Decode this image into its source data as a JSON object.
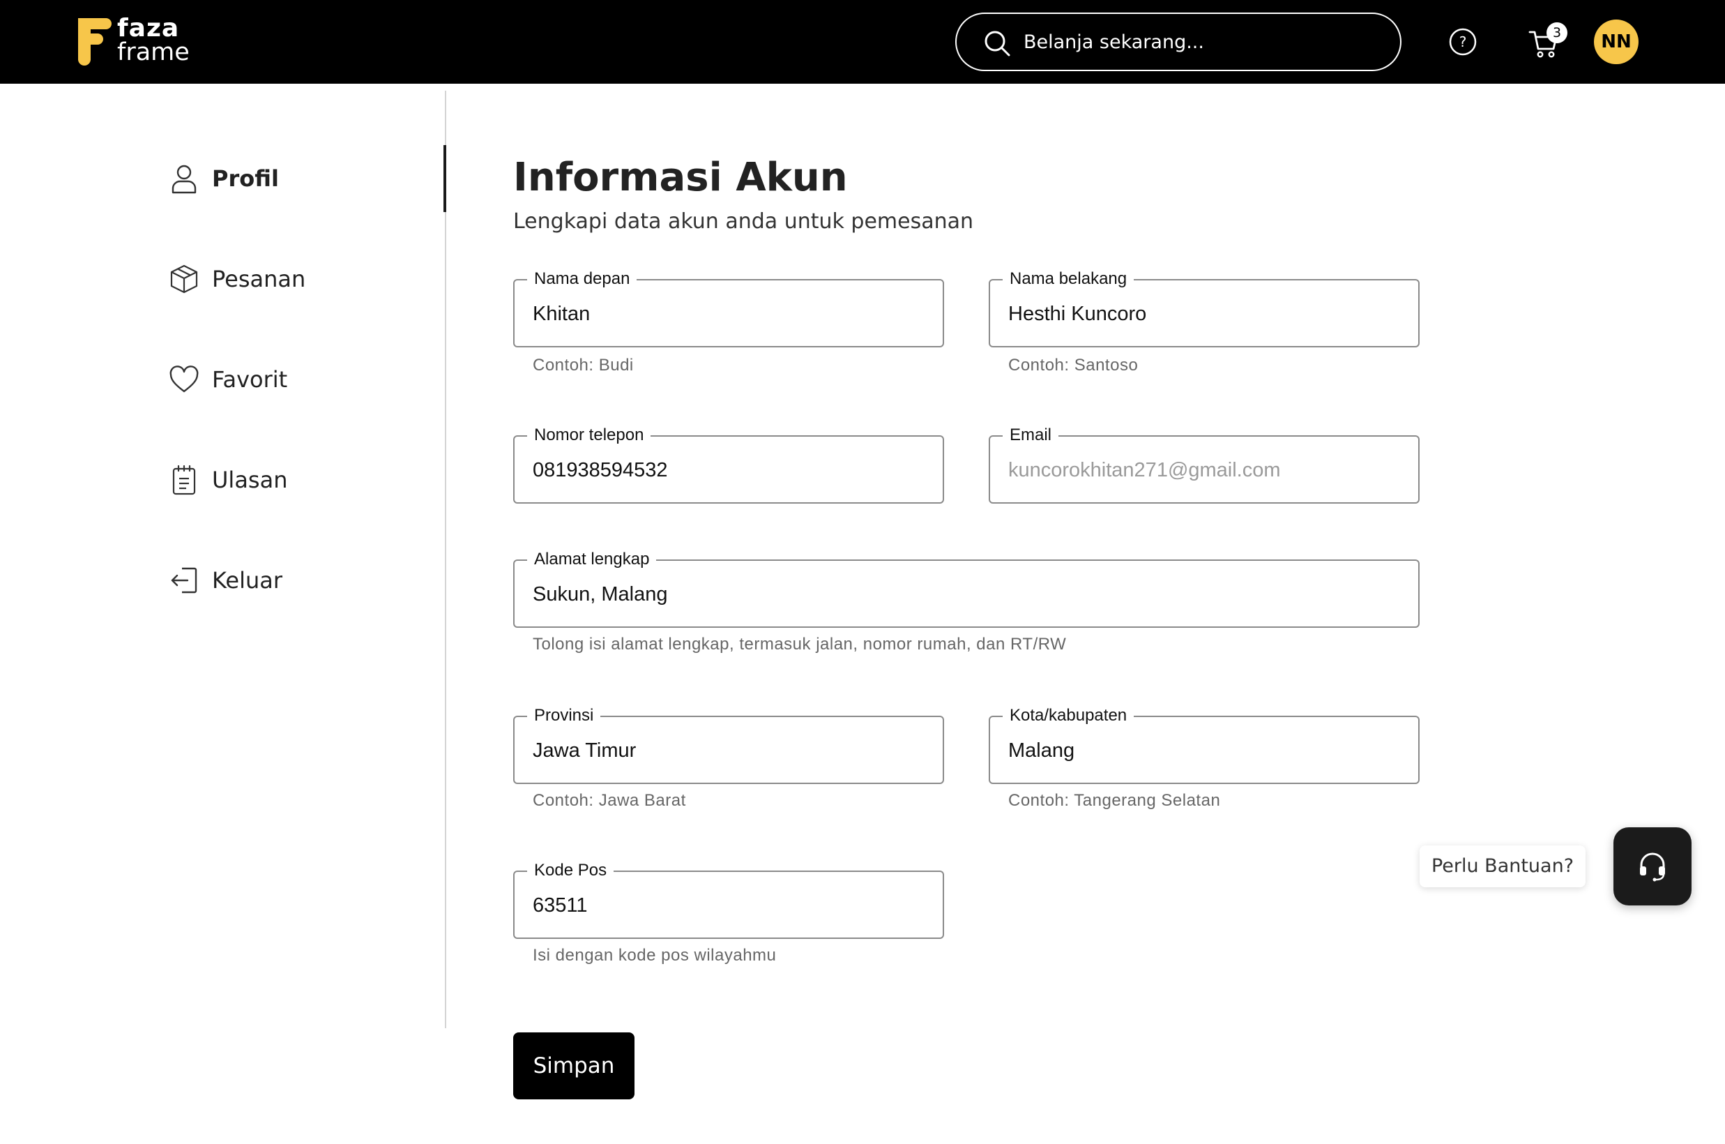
{
  "header": {
    "logo_line1": "faza",
    "logo_line2": "frame",
    "search_placeholder": "Belanja sekarang...",
    "help_icon": "question-circle-icon",
    "cart_icon": "shopping-cart-icon",
    "cart_count": "3",
    "avatar_initials": "NN"
  },
  "sidebar": {
    "items": [
      {
        "label": "Profil",
        "icon": "user-icon",
        "active": true
      },
      {
        "label": "Pesanan",
        "icon": "package-box-icon",
        "active": false
      },
      {
        "label": "Favorit",
        "icon": "heart-icon",
        "active": false
      },
      {
        "label": "Ulasan",
        "icon": "notepad-icon",
        "active": false
      },
      {
        "label": "Keluar",
        "icon": "logout-icon",
        "active": false
      }
    ]
  },
  "main": {
    "title": "Informasi Akun",
    "subtitle": "Lengkapi data akun anda untuk pemesanan",
    "fields": {
      "first_name": {
        "label": "Nama depan",
        "value": "Khitan",
        "helper": "Contoh: Budi"
      },
      "last_name": {
        "label": "Nama belakang",
        "value": "Hesthi Kuncoro",
        "helper": "Contoh: Santoso"
      },
      "phone": {
        "label": "Nomor telepon",
        "value": "081938594532"
      },
      "email": {
        "label": "Email",
        "value": "kuncorokhitan271@gmail.com",
        "disabled": true
      },
      "address": {
        "label": "Alamat lengkap",
        "value": "Sukun, Malang",
        "helper": "Tolong isi alamat lengkap, termasuk jalan, nomor rumah, dan RT/RW"
      },
      "province": {
        "label": "Provinsi",
        "value": "Jawa Timur",
        "helper": "Contoh: Jawa Barat"
      },
      "city": {
        "label": "Kota/kabupaten",
        "value": "Malang",
        "helper": "Contoh: Tangerang Selatan"
      },
      "postal_code": {
        "label": "Kode Pos",
        "value": "63511",
        "helper": "Isi dengan kode pos wilayahmu"
      }
    },
    "save_label": "Simpan"
  },
  "help_widget": {
    "label": "Perlu Bantuan?",
    "icon": "headset-icon"
  },
  "colors": {
    "header_bg": "#000000",
    "logo_yellow": "#f7c64a",
    "avatar_bg": "#f7c64a",
    "button_bg": "#000000",
    "field_border": "#8a8a8a"
  }
}
